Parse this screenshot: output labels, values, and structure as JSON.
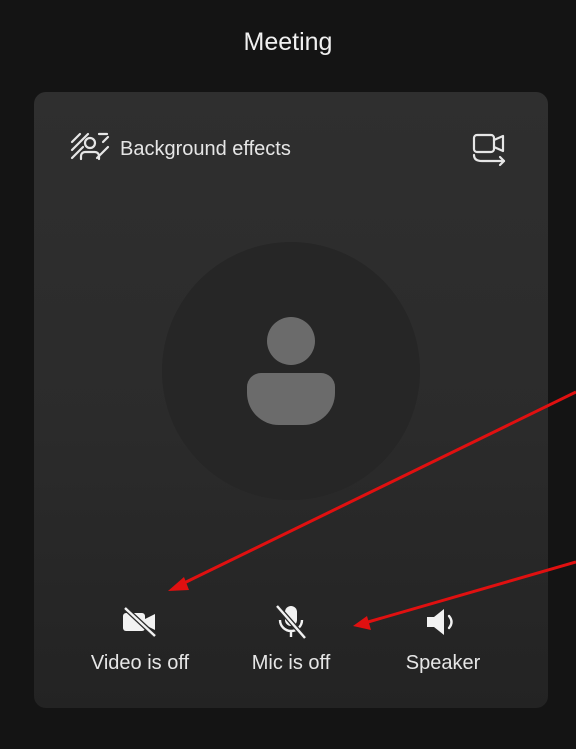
{
  "header": {
    "title": "Meeting"
  },
  "panel": {
    "background_effects_label": "Background effects"
  },
  "controls": {
    "video_label": "Video is off",
    "mic_label": "Mic is off",
    "speaker_label": "Speaker"
  },
  "colors": {
    "background": "#141414",
    "panel": "#2d2d2d",
    "avatar_circle": "#262626",
    "avatar_figure": "#6b6b6b",
    "icon": "#f2f2f2",
    "annotation_arrow": "#e01010"
  },
  "icons": [
    "background-effects-icon",
    "switch-camera-icon",
    "video-off-icon",
    "mic-off-icon",
    "speaker-icon",
    "person-avatar-icon"
  ]
}
